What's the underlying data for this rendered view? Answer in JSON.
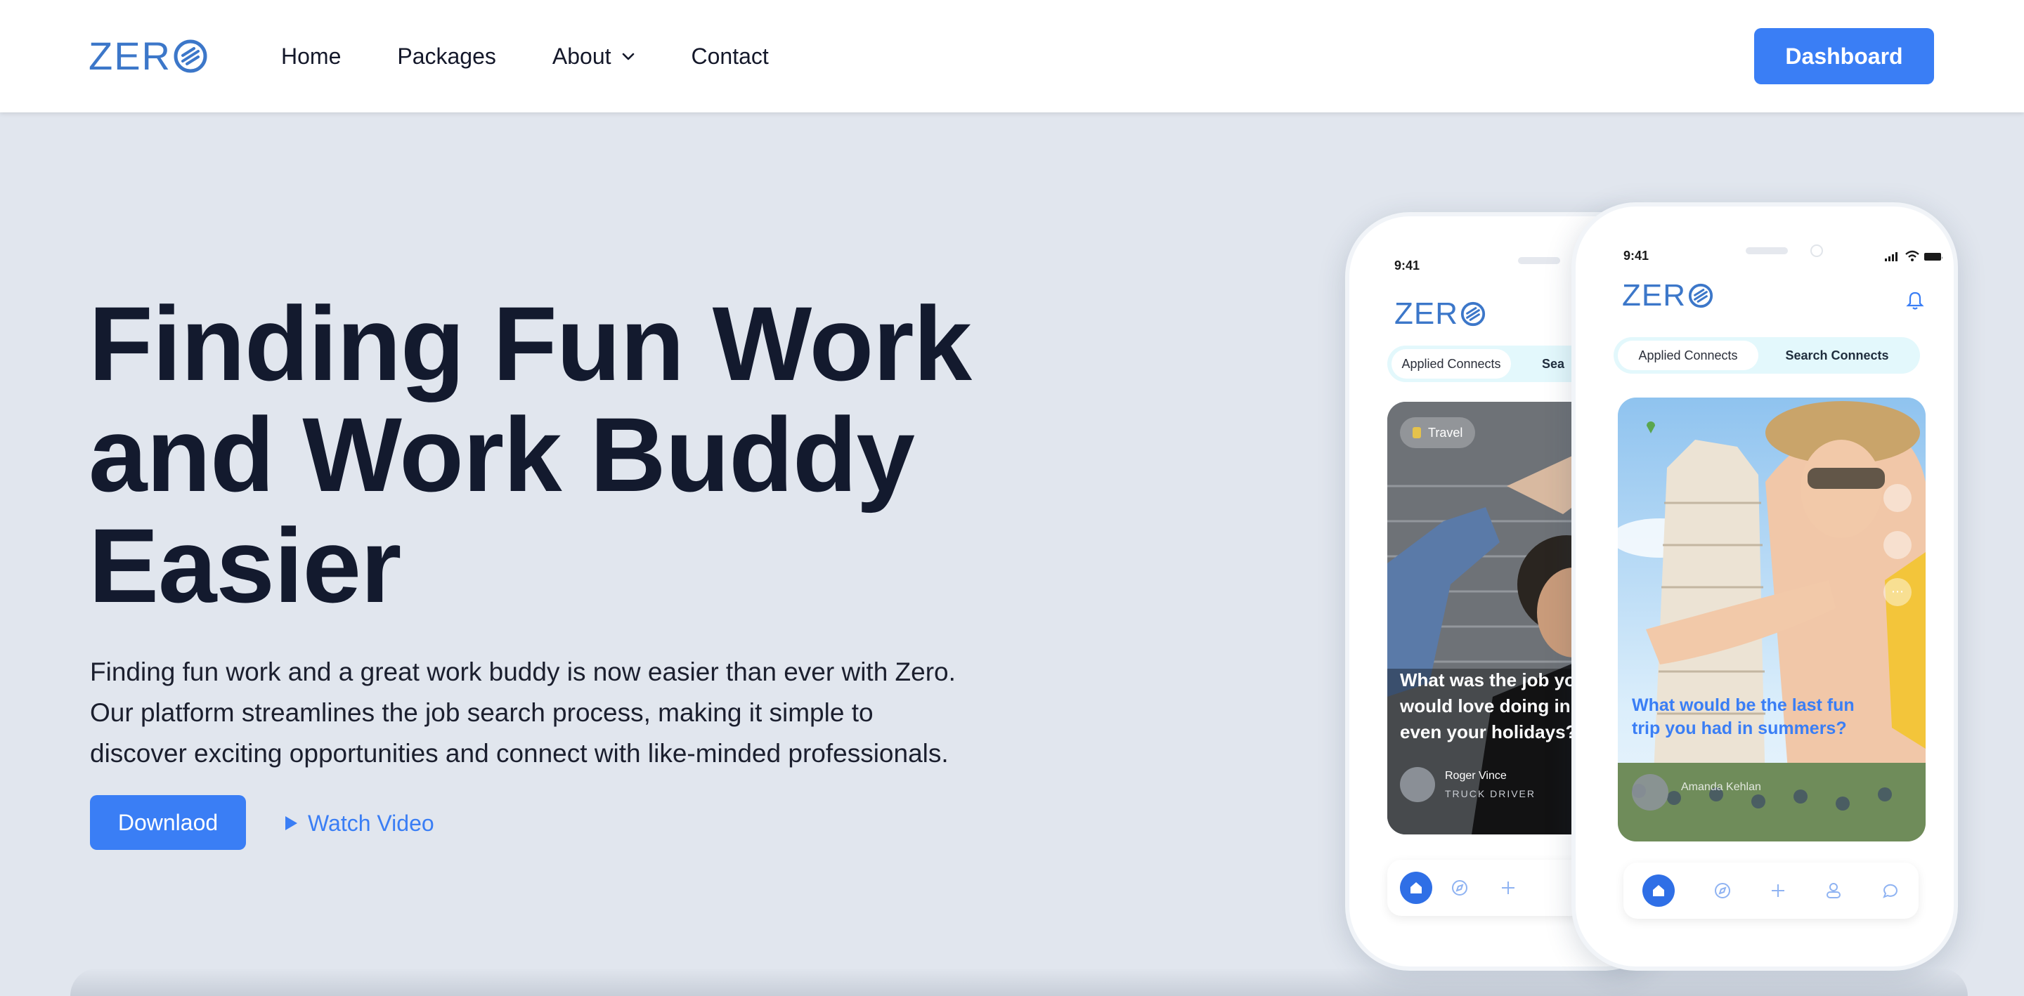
{
  "brand": {
    "logo_text": "ZER",
    "accent": "#3a7ef5",
    "logo_color": "#3c77c9",
    "dark_text": "#131a2e"
  },
  "nav": {
    "links": [
      {
        "label": "Home"
      },
      {
        "label": "Packages"
      },
      {
        "label": "About",
        "has_dropdown": true,
        "icon": "chevron-down-icon"
      },
      {
        "label": "Contact"
      }
    ],
    "cta": "Dashboard"
  },
  "hero": {
    "title": "Finding Fun Work\nand Work Buddy\nEasier",
    "description": "Finding fun work and a great work buddy is now easier than ever with Zero.\nOur platform streamlines the job search process, making it simple to\ndiscover exciting opportunities and connect with like-minded professionals.",
    "download_label": "Downlaod",
    "watch_video_label": "Watch Video"
  },
  "phone_back": {
    "time": "9:41",
    "logo_text": "ZER",
    "tab_active": "Applied Connects",
    "tab_other": "Sea",
    "card_tag": "Travel",
    "card_question": "What was the job yo\nwould love doing in\neven your holidays?",
    "card_author": "Roger Vince",
    "card_role": "TRUCK DRIVER"
  },
  "phone_front": {
    "time": "9:41",
    "logo_text": "ZER",
    "tab_active": "Applied Connects",
    "tab_other": "Search Connects",
    "card_question": "What would be the last fun\ntrip you had in summers?",
    "card_author": "Amanda Kehlan"
  }
}
